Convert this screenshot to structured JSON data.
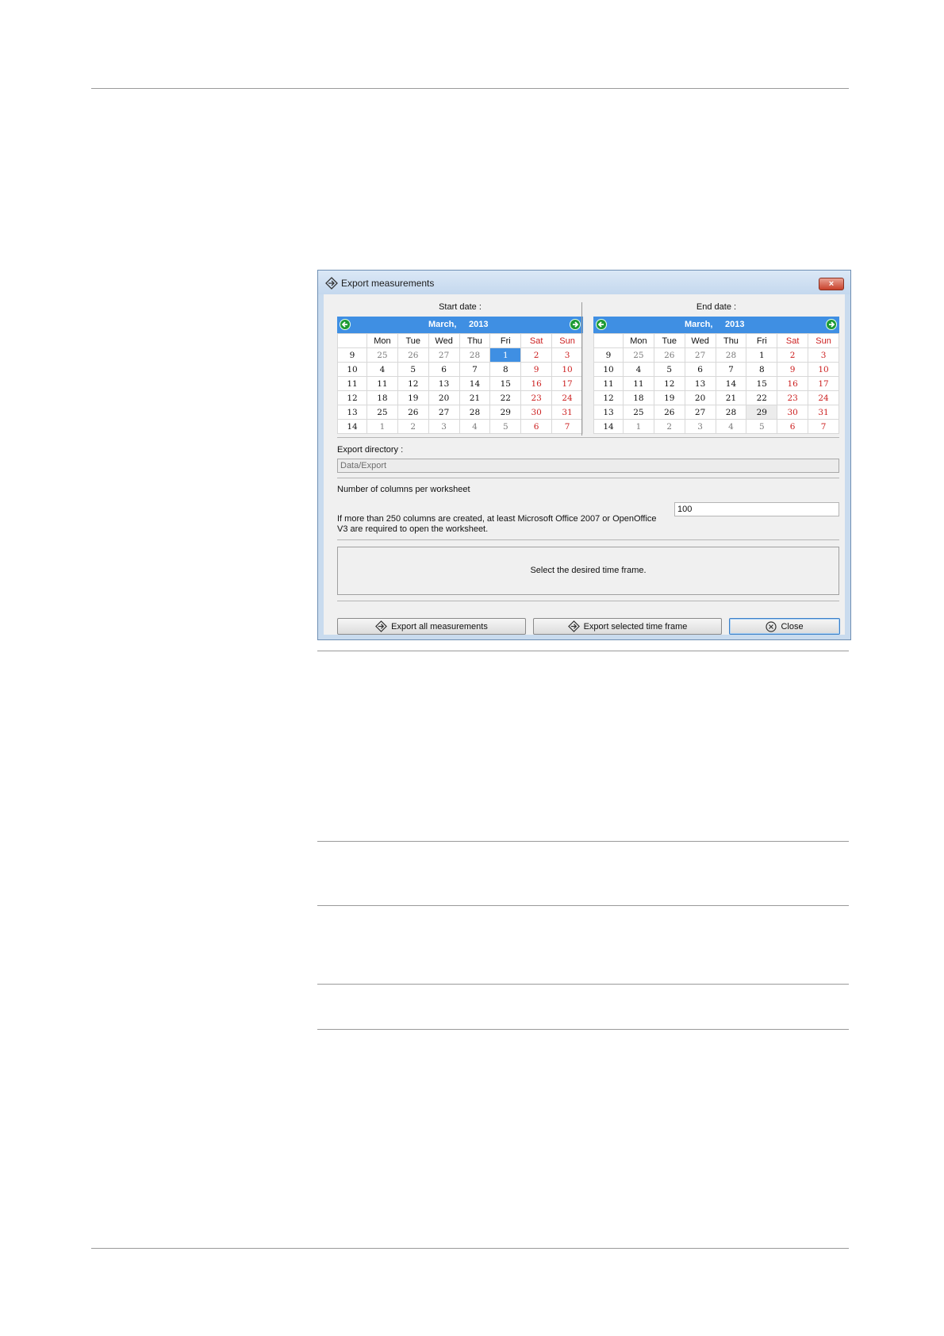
{
  "dialog": {
    "title": "Export measurements",
    "close_glyph": "×"
  },
  "start_calendar": {
    "caption": "Start date :",
    "month": "March,",
    "year": "2013",
    "headers": [
      "",
      "Mon",
      "Tue",
      "Wed",
      "Thu",
      "Fri",
      "Sat",
      "Sun"
    ],
    "rows": [
      [
        "9",
        "25",
        "26",
        "27",
        "28",
        "1",
        "2",
        "3"
      ],
      [
        "10",
        "4",
        "5",
        "6",
        "7",
        "8",
        "9",
        "10"
      ],
      [
        "11",
        "11",
        "12",
        "13",
        "14",
        "15",
        "16",
        "17"
      ],
      [
        "12",
        "18",
        "19",
        "20",
        "21",
        "22",
        "23",
        "24"
      ],
      [
        "13",
        "25",
        "26",
        "27",
        "28",
        "29",
        "30",
        "31"
      ],
      [
        "14",
        "1",
        "2",
        "3",
        "4",
        "5",
        "6",
        "7"
      ]
    ],
    "selected": "1"
  },
  "end_calendar": {
    "caption": "End date :",
    "month": "March,",
    "year": "2013",
    "headers": [
      "",
      "Mon",
      "Tue",
      "Wed",
      "Thu",
      "Fri",
      "Sat",
      "Sun"
    ],
    "rows": [
      [
        "9",
        "25",
        "26",
        "27",
        "28",
        "1",
        "2",
        "3"
      ],
      [
        "10",
        "4",
        "5",
        "6",
        "7",
        "8",
        "9",
        "10"
      ],
      [
        "11",
        "11",
        "12",
        "13",
        "14",
        "15",
        "16",
        "17"
      ],
      [
        "12",
        "18",
        "19",
        "20",
        "21",
        "22",
        "23",
        "24"
      ],
      [
        "13",
        "25",
        "26",
        "27",
        "28",
        "29",
        "30",
        "31"
      ],
      [
        "14",
        "1",
        "2",
        "3",
        "4",
        "5",
        "6",
        "7"
      ]
    ],
    "highlighted": "29"
  },
  "export_directory": {
    "label": "Export directory :",
    "value": "Data/Export"
  },
  "columns": {
    "label": "Number of columns per worksheet",
    "value": "100",
    "note": "If more than 250 columns are created, at least Microsoft Office 2007 or OpenOffice V3 are required to open the worksheet."
  },
  "message": "Select the desired time frame.",
  "buttons": {
    "export_all": "Export all measurements",
    "export_selected": "Export selected time frame",
    "close": "Close"
  },
  "icons": {
    "title": "export-icon",
    "prev_month": "arrow-left-icon",
    "next_month": "arrow-right-icon",
    "export": "export-icon",
    "close": "close-circle-icon"
  },
  "colors": {
    "calendar_header": "#3f8fe3",
    "weekend": "#cc1f1f",
    "nav_button": "#1d9a34"
  }
}
